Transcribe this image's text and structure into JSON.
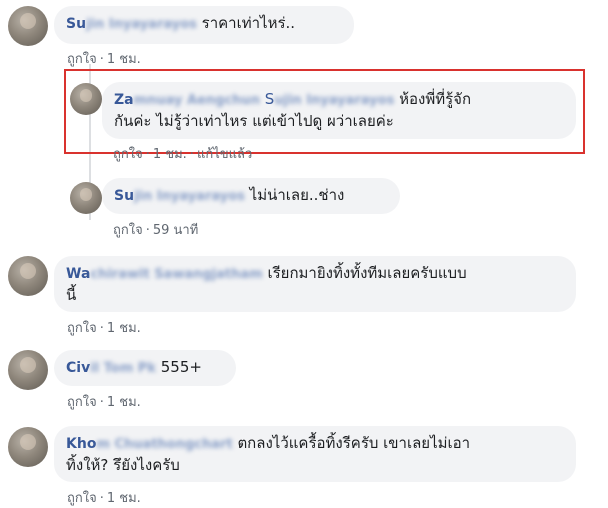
{
  "comments": [
    {
      "name_visible": "Su",
      "name_blurred": "jin Inyayarayos",
      "text": "ราคาเท่าไหร่..",
      "like": "ถูกใจ",
      "time": "1 ชม."
    },
    {
      "name_visible": "Za",
      "name_blurred": "mnuay Aengchun",
      "mention_visible": "S",
      "mention_blurred": "ujin Inyayarayos",
      "text_line1": "ห้องพี่ที่รู้จัก",
      "text_line2": "กันค่ะ ไม่รู้ว่าเท่าไหร แต่เข้าไปดู ผว่าเลยค่ะ",
      "like": "ถูกใจ",
      "time": "1 ชม.",
      "edited": "แก้ไขแล้ว"
    },
    {
      "name_visible": "Su",
      "name_blurred": "jin Inyayarayos",
      "text": "ไม่น่าเลย..ช่าง",
      "like": "ถูกใจ",
      "time": "59 นาที"
    },
    {
      "name_visible": "Wa",
      "name_blurred": "chirawit Sawangjatham",
      "text_line1": "เรียกมายิงทิ้งทั้งทีมเลยครับแบบ",
      "text_line2": "นี้",
      "like": "ถูกใจ",
      "time": "1 ชม."
    },
    {
      "name_visible": "Civ",
      "name_blurred": "il Tom Pk",
      "text": "555+",
      "like": "ถูกใจ",
      "time": "1 ชม."
    },
    {
      "name_visible": "Kho",
      "name_blurred": "m Chuathongchart",
      "text_line1": "ตกลงไว้แครื้อทิ้งรีครับ เขาเลยไม่เอา",
      "text_line2": "ทิ้งให้? รึยังไงครับ",
      "like": "ถูกใจ",
      "time": "1 ชม."
    }
  ],
  "separator": "·"
}
